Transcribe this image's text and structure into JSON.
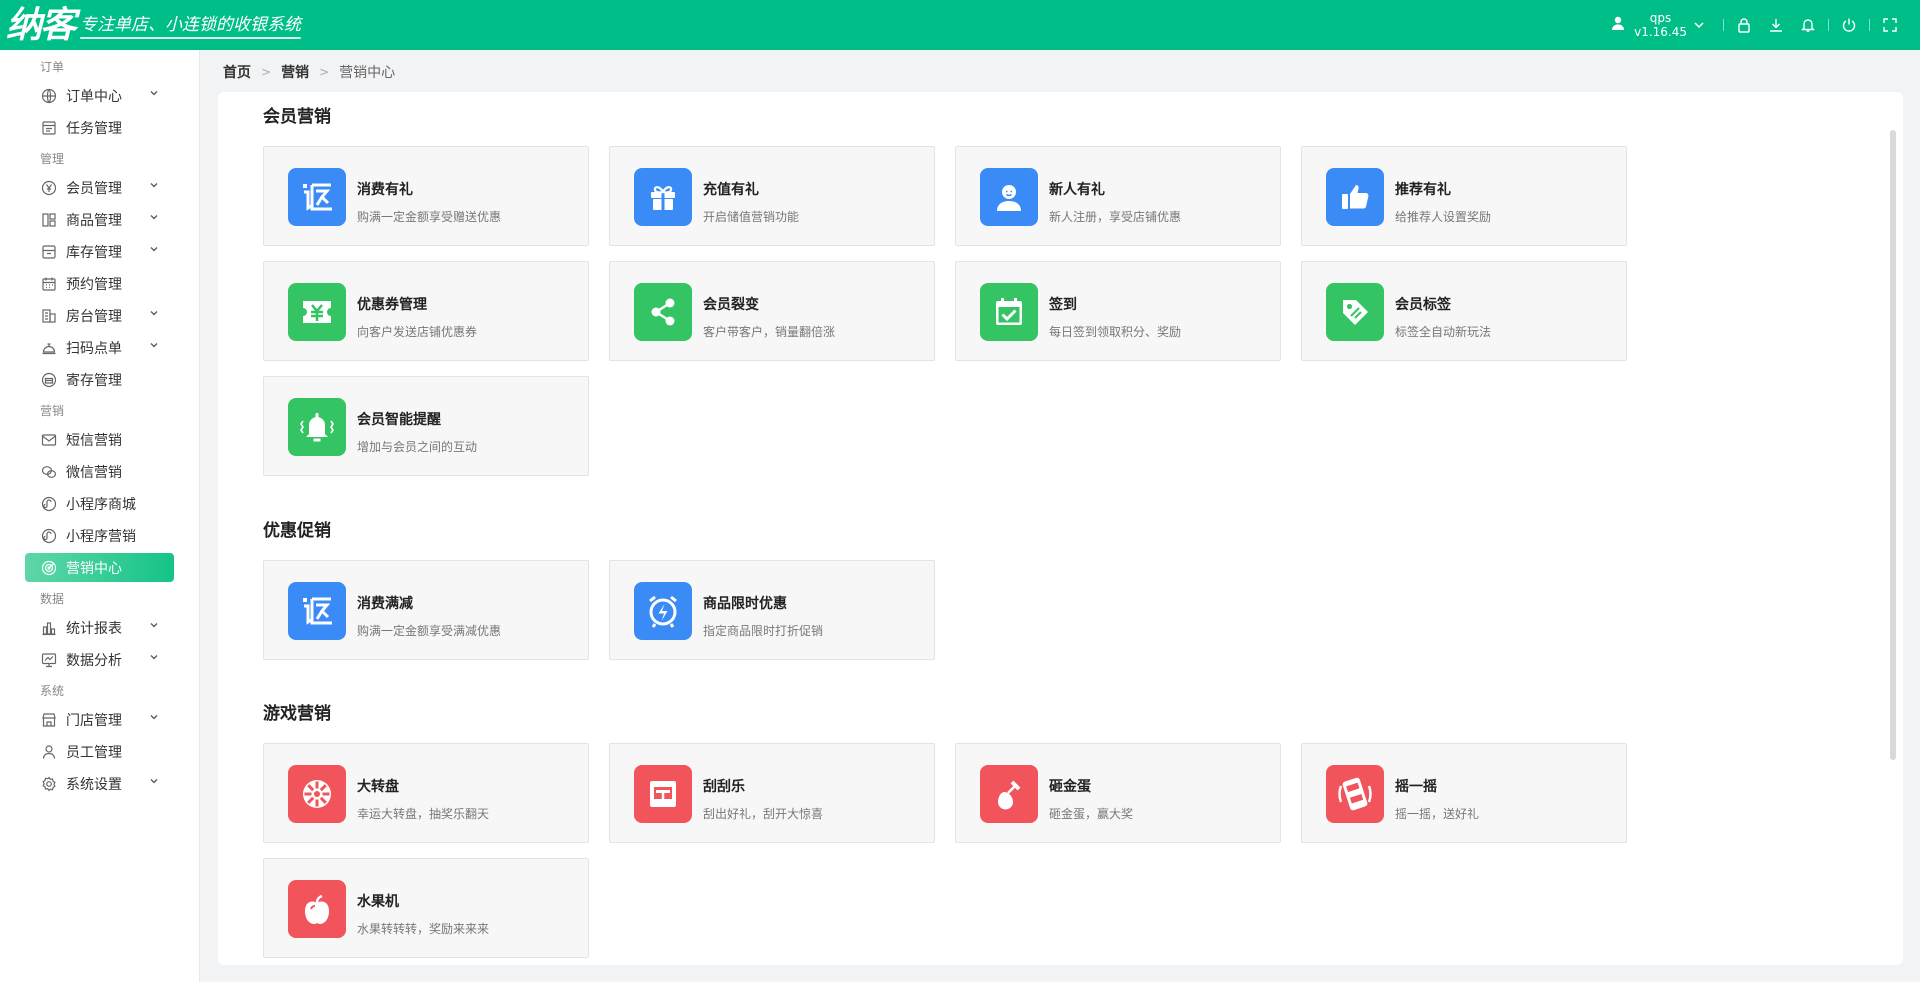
{
  "header": {
    "logo_text": "纳客",
    "slogan": "专注单店、小连锁的收银系统",
    "username": "qps",
    "version": "v1.16.45"
  },
  "sidebar": {
    "groups": [
      {
        "title": "订单",
        "items": [
          {
            "label": "订单中心",
            "icon": "globe-icon",
            "expandable": true
          },
          {
            "label": "任务管理",
            "icon": "task-icon",
            "expandable": false
          }
        ]
      },
      {
        "title": "管理",
        "items": [
          {
            "label": "会员管理",
            "icon": "yen-circle-icon",
            "expandable": true
          },
          {
            "label": "商品管理",
            "icon": "product-grid-icon",
            "expandable": true
          },
          {
            "label": "库存管理",
            "icon": "inventory-icon",
            "expandable": true
          },
          {
            "label": "预约管理",
            "icon": "calendar-icon",
            "expandable": false
          },
          {
            "label": "房台管理",
            "icon": "building-icon",
            "expandable": true
          },
          {
            "label": "扫码点单",
            "icon": "service-bell-icon",
            "expandable": true
          },
          {
            "label": "寄存管理",
            "icon": "storage-icon",
            "expandable": false
          }
        ]
      },
      {
        "title": "营销",
        "items": [
          {
            "label": "短信营销",
            "icon": "mail-icon",
            "expandable": false
          },
          {
            "label": "微信营销",
            "icon": "wechat-icon",
            "expandable": false
          },
          {
            "label": "小程序商城",
            "icon": "miniprogram-icon",
            "expandable": false
          },
          {
            "label": "小程序营销",
            "icon": "miniprogram-icon",
            "expandable": false
          },
          {
            "label": "营销中心",
            "icon": "target-icon",
            "expandable": false,
            "active": true
          }
        ]
      },
      {
        "title": "数据",
        "items": [
          {
            "label": "统计报表",
            "icon": "bar-chart-icon",
            "expandable": true
          },
          {
            "label": "数据分析",
            "icon": "monitor-chart-icon",
            "expandable": true
          }
        ]
      },
      {
        "title": "系统",
        "items": [
          {
            "label": "门店管理",
            "icon": "store-icon",
            "expandable": true
          },
          {
            "label": "员工管理",
            "icon": "user-icon",
            "expandable": false
          },
          {
            "label": "系统设置",
            "icon": "gear-icon",
            "expandable": true
          }
        ]
      }
    ]
  },
  "breadcrumb": [
    "首页",
    "营销",
    "营销中心"
  ],
  "sections": [
    {
      "title": "会员营销",
      "cards": [
        {
          "title": "消费有礼",
          "desc": "购满一定金额享受赠送优惠",
          "color": "#3a8bf6",
          "icon": "return-icon"
        },
        {
          "title": "充值有礼",
          "desc": "开启储值营销功能",
          "color": "#3a8bf6",
          "icon": "gift-icon"
        },
        {
          "title": "新人有礼",
          "desc": "新人注册，享受店铺优惠",
          "color": "#3a8bf6",
          "icon": "person-icon"
        },
        {
          "title": "推荐有礼",
          "desc": "给推荐人设置奖励",
          "color": "#3a8bf6",
          "icon": "thumbs-up-icon"
        },
        {
          "title": "优惠券管理",
          "desc": "向客户发送店铺优惠券",
          "color": "#34c463",
          "icon": "coupon-icon"
        },
        {
          "title": "会员裂变",
          "desc": "客户带客户，销量翻倍涨",
          "color": "#34c463",
          "icon": "share-icon"
        },
        {
          "title": "签到",
          "desc": "每日签到领取积分、奖励",
          "color": "#34c463",
          "icon": "calendar-check-icon"
        },
        {
          "title": "会员标签",
          "desc": "标签全自动新玩法",
          "color": "#34c463",
          "icon": "tag-icon"
        },
        {
          "title": "会员智能提醒",
          "desc": "增加与会员之间的互动",
          "color": "#34c463",
          "icon": "bell-icon"
        }
      ]
    },
    {
      "title": "优惠促销",
      "cards": [
        {
          "title": "消费满减",
          "desc": "购满一定金额享受满减优惠",
          "color": "#3a8bf6",
          "icon": "return-icon"
        },
        {
          "title": "商品限时优惠",
          "desc": "指定商品限时打折促销",
          "color": "#3a8bf6",
          "icon": "alarm-clock-icon"
        }
      ]
    },
    {
      "title": "游戏营销",
      "cards": [
        {
          "title": "大转盘",
          "desc": "幸运大转盘，抽奖乐翻天",
          "color": "#f2545b",
          "icon": "wheel-icon"
        },
        {
          "title": "刮刮乐",
          "desc": "刮出好礼，刮开大惊喜",
          "color": "#f2545b",
          "icon": "scratch-card-icon"
        },
        {
          "title": "砸金蛋",
          "desc": "砸金蛋，赢大奖",
          "color": "#f2545b",
          "icon": "hammer-egg-icon"
        },
        {
          "title": "摇一摇",
          "desc": "摇一摇，送好礼",
          "color": "#f2545b",
          "icon": "shake-phone-icon"
        },
        {
          "title": "水果机",
          "desc": "水果转转转，奖励来来来",
          "color": "#f2545b",
          "icon": "apple-icon"
        }
      ]
    }
  ]
}
